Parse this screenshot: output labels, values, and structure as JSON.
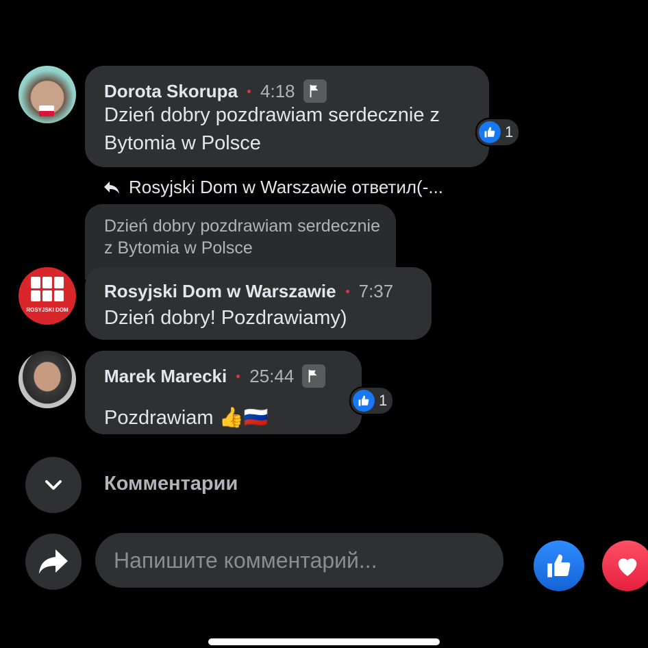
{
  "comments": [
    {
      "author": "Dorota Skorupa",
      "time": "4:18",
      "text": "Dzień dobry pozdrawiam serdecznie z Bytomia w Polsce",
      "likes": "1",
      "avatar_icon": "user-photo-avatar"
    },
    {
      "reply_header": "Rosyjski Dom w Warszawie ответил(-...",
      "quoted_text": "Dzień dobry pozdrawiam serdecznie z Bytomia w Polsce",
      "author": "Rosyjski Dom w Warszawie",
      "time": "7:37",
      "text": "Dzień dobry! Pozdrawiamy)",
      "avatar_icon": "page-logo-avatar",
      "avatar_logo_text": "ROSYJSKI DOM"
    },
    {
      "author": "Marek Marecki",
      "time": "25:44",
      "text": "Pozdrawiam 👍🇷🇺",
      "likes": "1",
      "avatar_icon": "user-photo-avatar"
    }
  ],
  "section": {
    "collapse_label": "Комментарии",
    "collapse_icon": "chevron-down-icon"
  },
  "composer": {
    "placeholder": "Напишите комментарий...",
    "share_icon": "share-icon",
    "like_icon": "thumbs-up-icon",
    "love_icon": "heart-icon"
  },
  "colors": {
    "background": "#000000",
    "bubble": "#2f3031",
    "like_blue": "#1877f2",
    "love_red": "#e5203f",
    "dot_red": "#e4314b"
  }
}
